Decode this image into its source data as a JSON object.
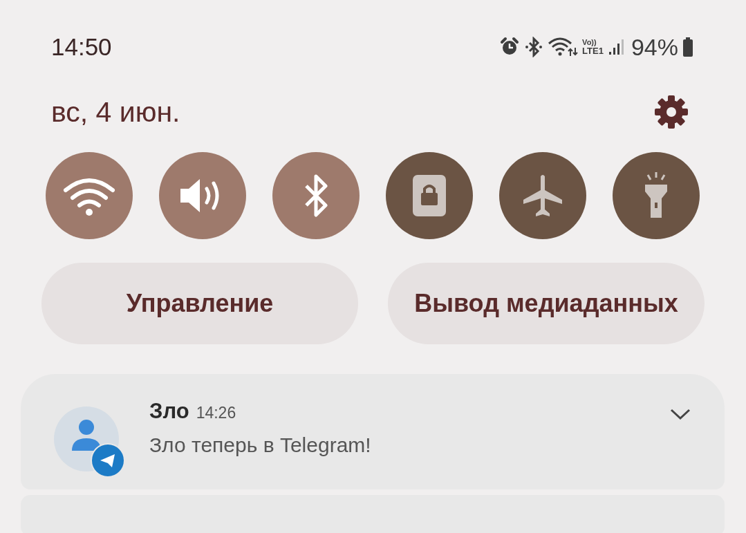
{
  "status_bar": {
    "time": "14:50",
    "volte": "Vo))",
    "network": "LTE1",
    "battery": "94%"
  },
  "header": {
    "date": "вс, 4 июн."
  },
  "quick_tiles": [
    {
      "kind": "wifi",
      "on": true
    },
    {
      "kind": "sound",
      "on": true
    },
    {
      "kind": "bluetooth",
      "on": true
    },
    {
      "kind": "lock",
      "on": false
    },
    {
      "kind": "airplane",
      "on": false
    },
    {
      "kind": "flashlight",
      "on": false
    }
  ],
  "buttons": [
    "Управление",
    "Вывод медиаданных"
  ],
  "notification": {
    "title": "Зло",
    "time": "14:26",
    "text": "Зло теперь в Telegram!"
  }
}
